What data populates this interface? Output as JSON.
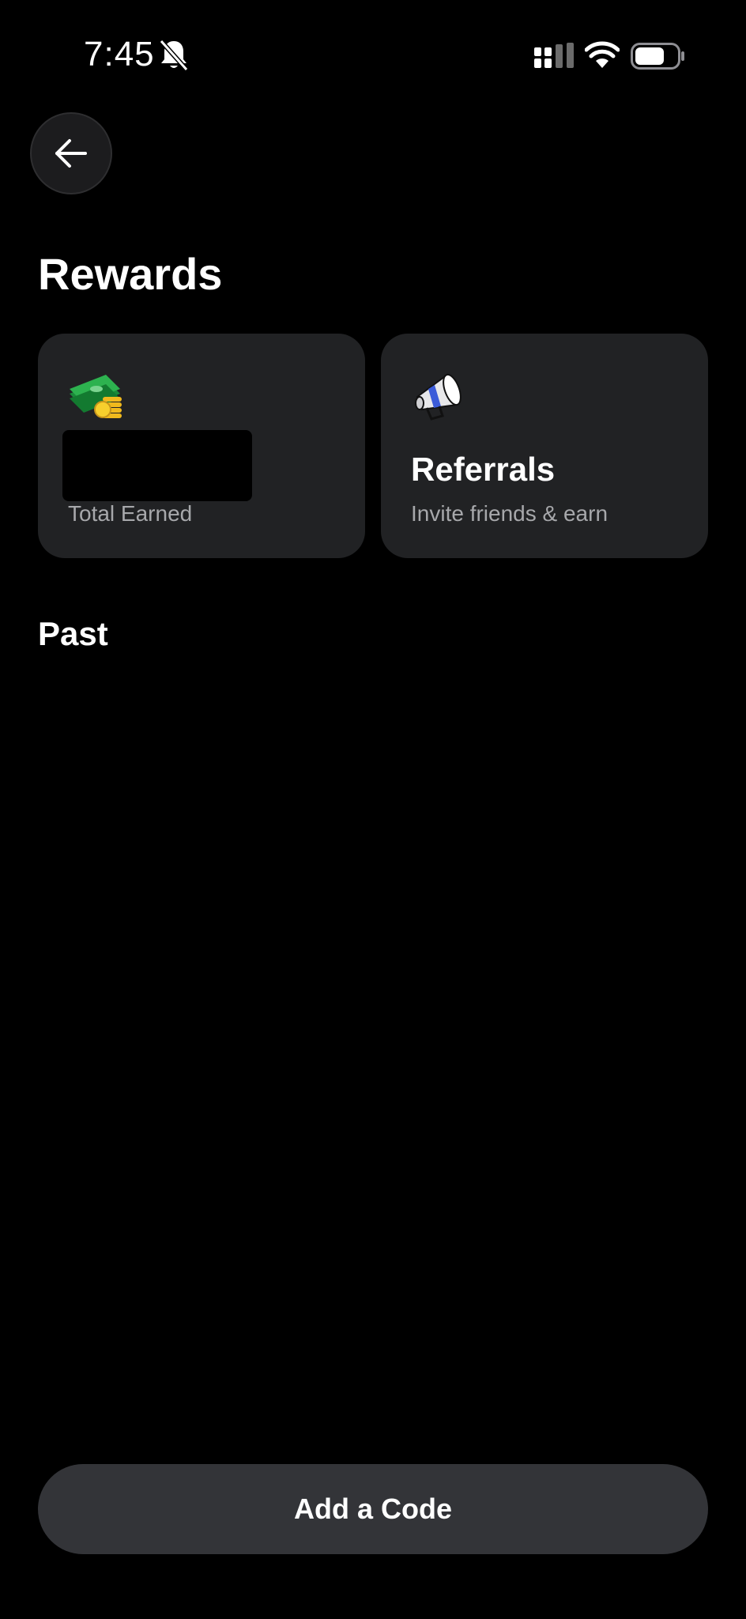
{
  "status_bar": {
    "time": "7:45",
    "icons": [
      "bell-slash-icon",
      "signal-icon",
      "wifi-icon",
      "battery-icon"
    ]
  },
  "header": {
    "back_icon": "arrow-left-icon"
  },
  "page": {
    "title": "Rewards"
  },
  "cards": {
    "earned": {
      "icon": "money-icon",
      "caption": "Total Earned"
    },
    "referrals": {
      "icon": "megaphone-icon",
      "title": "Referrals",
      "caption": "Invite friends & earn"
    }
  },
  "past_section": {
    "title": "Past"
  },
  "footer": {
    "button_label": "Add a Code"
  },
  "colors": {
    "background": "#000000",
    "card": "#212224",
    "button": "#333438",
    "muted_text": "#a7a8ab"
  }
}
